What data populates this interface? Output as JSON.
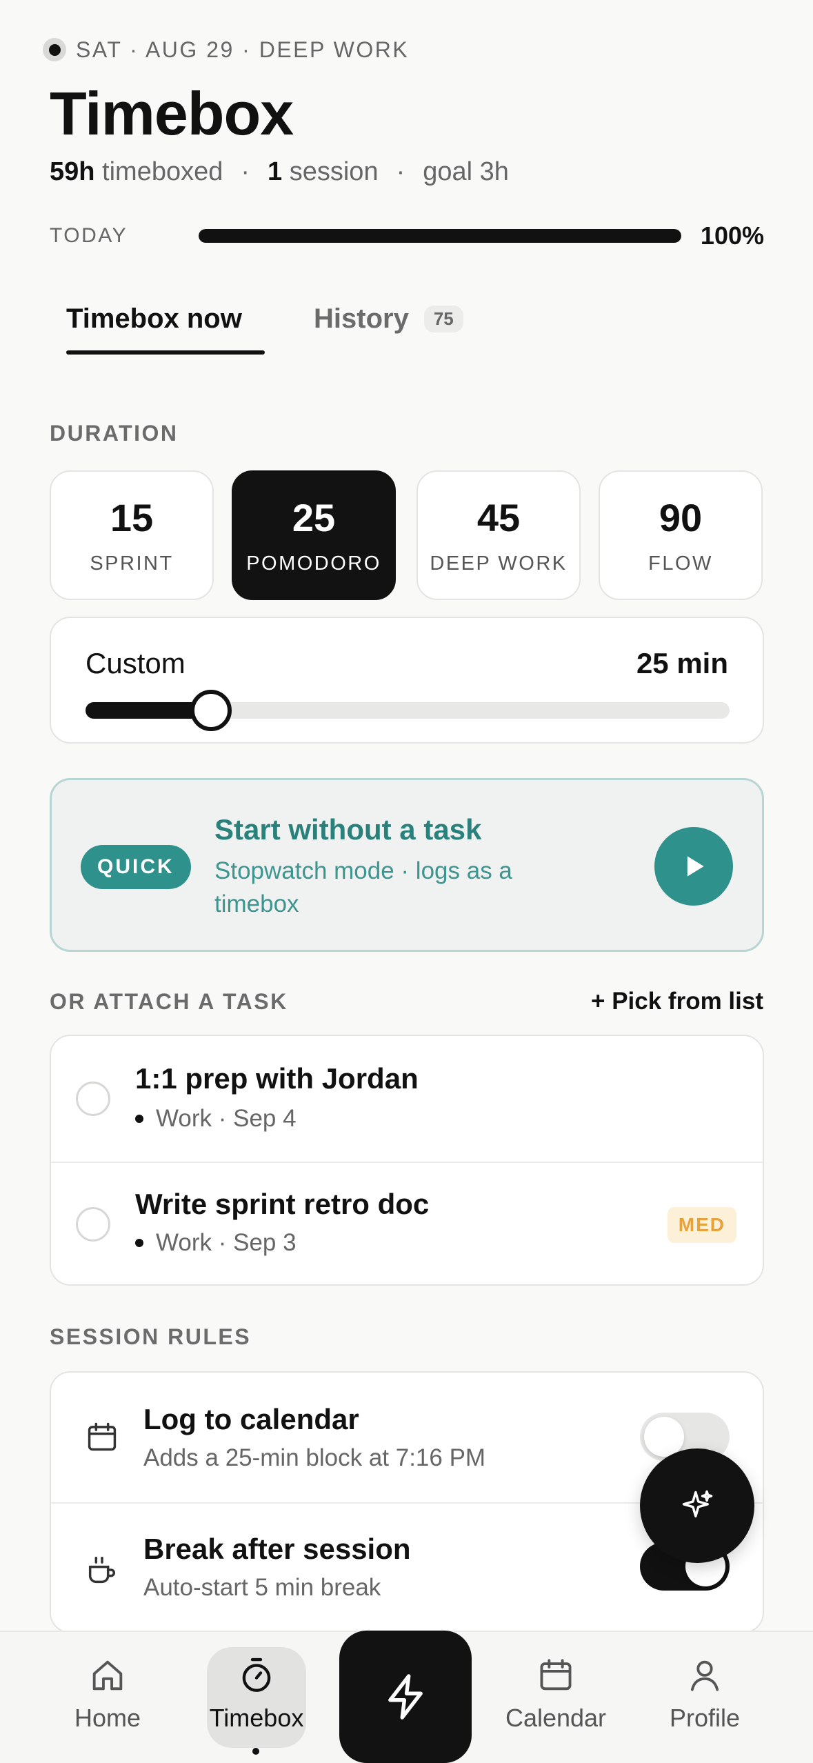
{
  "header": {
    "eyebrow": "SAT · AUG 29 · DEEP WORK",
    "title": "Timebox",
    "stats": {
      "hours_value": "59h",
      "hours_label": "timeboxed",
      "sessions_value": "1",
      "sessions_label": "session",
      "goal": "goal 3h",
      "separator": "·"
    },
    "today": {
      "label": "TODAY",
      "progress_percent": 100,
      "percent_text": "100%"
    }
  },
  "tabs": [
    {
      "label": "Timebox now",
      "active": true
    },
    {
      "label": "History",
      "badge": "75",
      "active": false
    }
  ],
  "duration": {
    "section_label": "DURATION",
    "options": [
      {
        "minutes": "15",
        "label": "SPRINT",
        "active": false
      },
      {
        "minutes": "25",
        "label": "POMODORO",
        "active": true
      },
      {
        "minutes": "45",
        "label": "DEEP WORK",
        "active": false
      },
      {
        "minutes": "90",
        "label": "FLOW",
        "active": false
      }
    ],
    "custom": {
      "label": "Custom",
      "value_text": "25 min",
      "slider_fraction": 0.195
    }
  },
  "quick": {
    "pill": "QUICK",
    "title": "Start without a task",
    "subtitle": "Stopwatch mode · logs as a timebox",
    "icon": "play-icon"
  },
  "attach": {
    "section_label": "OR ATTACH A TASK",
    "pick_link": "+ Pick from list",
    "tasks": [
      {
        "title": "1:1 prep with Jordan",
        "meta": "Work · Sep 4",
        "priority": ""
      },
      {
        "title": "Write sprint retro doc",
        "meta": "Work · Sep 3",
        "priority": "MED"
      }
    ]
  },
  "rules": {
    "section_label": "SESSION RULES",
    "items": [
      {
        "title": "Log to calendar",
        "subtitle": "Adds a 25-min block at 7:16 PM",
        "icon": "calendar-icon",
        "enabled": false
      },
      {
        "title": "Break after session",
        "subtitle": "Auto-start 5 min break",
        "icon": "coffee-icon",
        "enabled": true
      }
    ]
  },
  "fab": {
    "icon": "sparkle-icon"
  },
  "nav": {
    "items": [
      {
        "label": "Home",
        "icon": "home-icon",
        "active": false
      },
      {
        "label": "Timebox",
        "icon": "stopwatch-icon",
        "active": true
      },
      {
        "label": "Calendar",
        "icon": "calendar-icon",
        "active": false
      },
      {
        "label": "Profile",
        "icon": "profile-icon",
        "active": false
      }
    ],
    "center_icon": "lightning-icon"
  },
  "colors": {
    "accent_teal": "#2e918c",
    "priority_med": "#e5a23d",
    "ink": "#111111"
  }
}
